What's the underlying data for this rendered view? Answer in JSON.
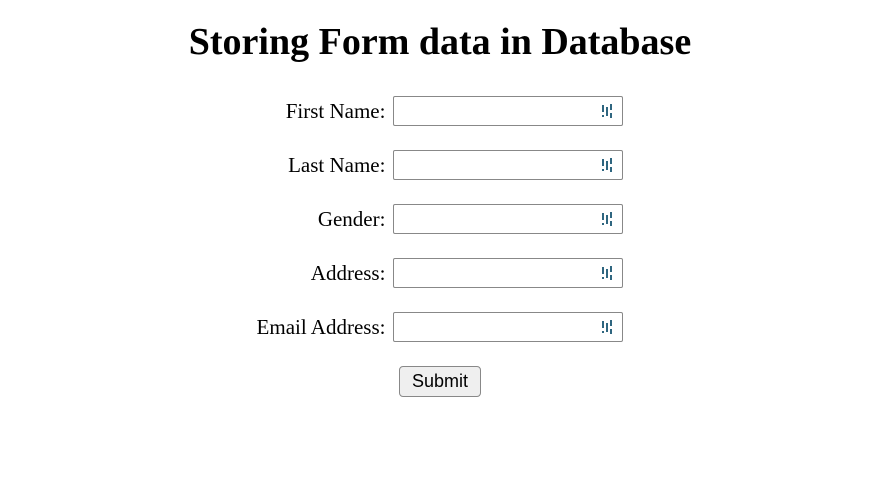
{
  "heading": "Storing Form data in Database",
  "form": {
    "fields": [
      {
        "label": "First Name:",
        "value": ""
      },
      {
        "label": "Last Name:",
        "value": ""
      },
      {
        "label": "Gender:",
        "value": ""
      },
      {
        "label": "Address:",
        "value": ""
      },
      {
        "label": "Email Address:",
        "value": ""
      }
    ],
    "submit_label": "Submit"
  },
  "icon_name": "password-manager-icon",
  "colors": {
    "icon": "#2f6680"
  }
}
